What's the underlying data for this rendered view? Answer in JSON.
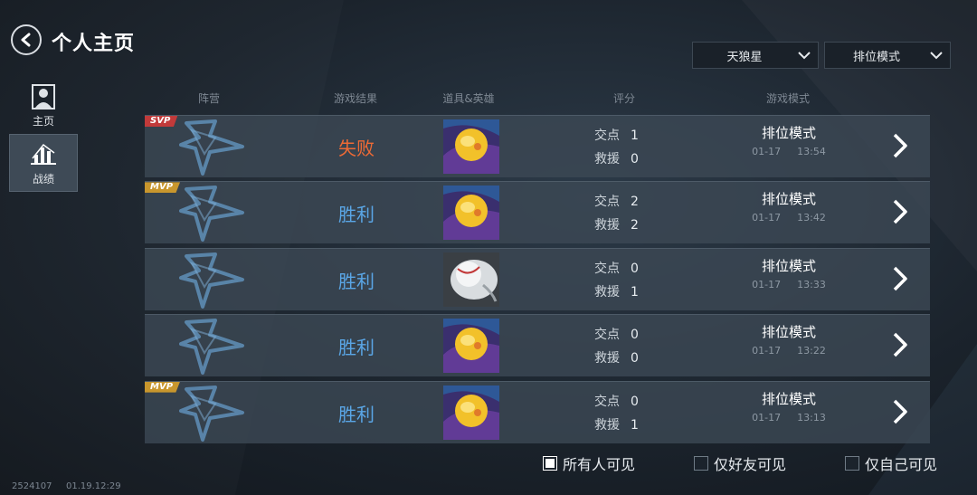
{
  "header": {
    "title": "个人主页",
    "server_dropdown": "天狼星",
    "mode_dropdown": "排位模式"
  },
  "sidebar": {
    "items": [
      {
        "label": "主页",
        "icon": "user-profile-icon",
        "active": false
      },
      {
        "label": "战绩",
        "icon": "bar-chart-icon",
        "active": true
      }
    ]
  },
  "table": {
    "columns": [
      "阵营",
      "游戏结果",
      "道具&英雄",
      "评分",
      "游戏模式"
    ],
    "stat_labels": {
      "points": "交点",
      "rescue": "救援"
    },
    "rows": [
      {
        "badge": "SVP",
        "result": "失败",
        "outcome": "lose",
        "hero": "yellow-ball-hero",
        "points": "1",
        "rescue": "0",
        "mode": "排位模式",
        "date": "01-17",
        "time": "13:54"
      },
      {
        "badge": "MVP",
        "result": "胜利",
        "outcome": "win",
        "hero": "yellow-ball-hero",
        "points": "2",
        "rescue": "2",
        "mode": "排位模式",
        "date": "01-17",
        "time": "13:42"
      },
      {
        "badge": "",
        "result": "胜利",
        "outcome": "win",
        "hero": "baseball-hero",
        "points": "0",
        "rescue": "1",
        "mode": "排位模式",
        "date": "01-17",
        "time": "13:33"
      },
      {
        "badge": "",
        "result": "胜利",
        "outcome": "win",
        "hero": "yellow-ball-hero",
        "points": "0",
        "rescue": "0",
        "mode": "排位模式",
        "date": "01-17",
        "time": "13:22"
      },
      {
        "badge": "MVP",
        "result": "胜利",
        "outcome": "win",
        "hero": "yellow-ball-hero",
        "points": "0",
        "rescue": "1",
        "mode": "排位模式",
        "date": "01-17",
        "time": "13:13"
      }
    ]
  },
  "visibility": {
    "options": [
      {
        "label": "所有人可见",
        "checked": true
      },
      {
        "label": "仅好友可见",
        "checked": false
      },
      {
        "label": "仅自己可见",
        "checked": false
      }
    ]
  },
  "footer": {
    "id": "2524107",
    "datetime": "01.19.12:29"
  },
  "colors": {
    "win": "#5aa6e6",
    "lose": "#ee6a35",
    "mvp": "#c8962d",
    "svp": "#c23a3a",
    "row_bg": "#3c4854"
  }
}
